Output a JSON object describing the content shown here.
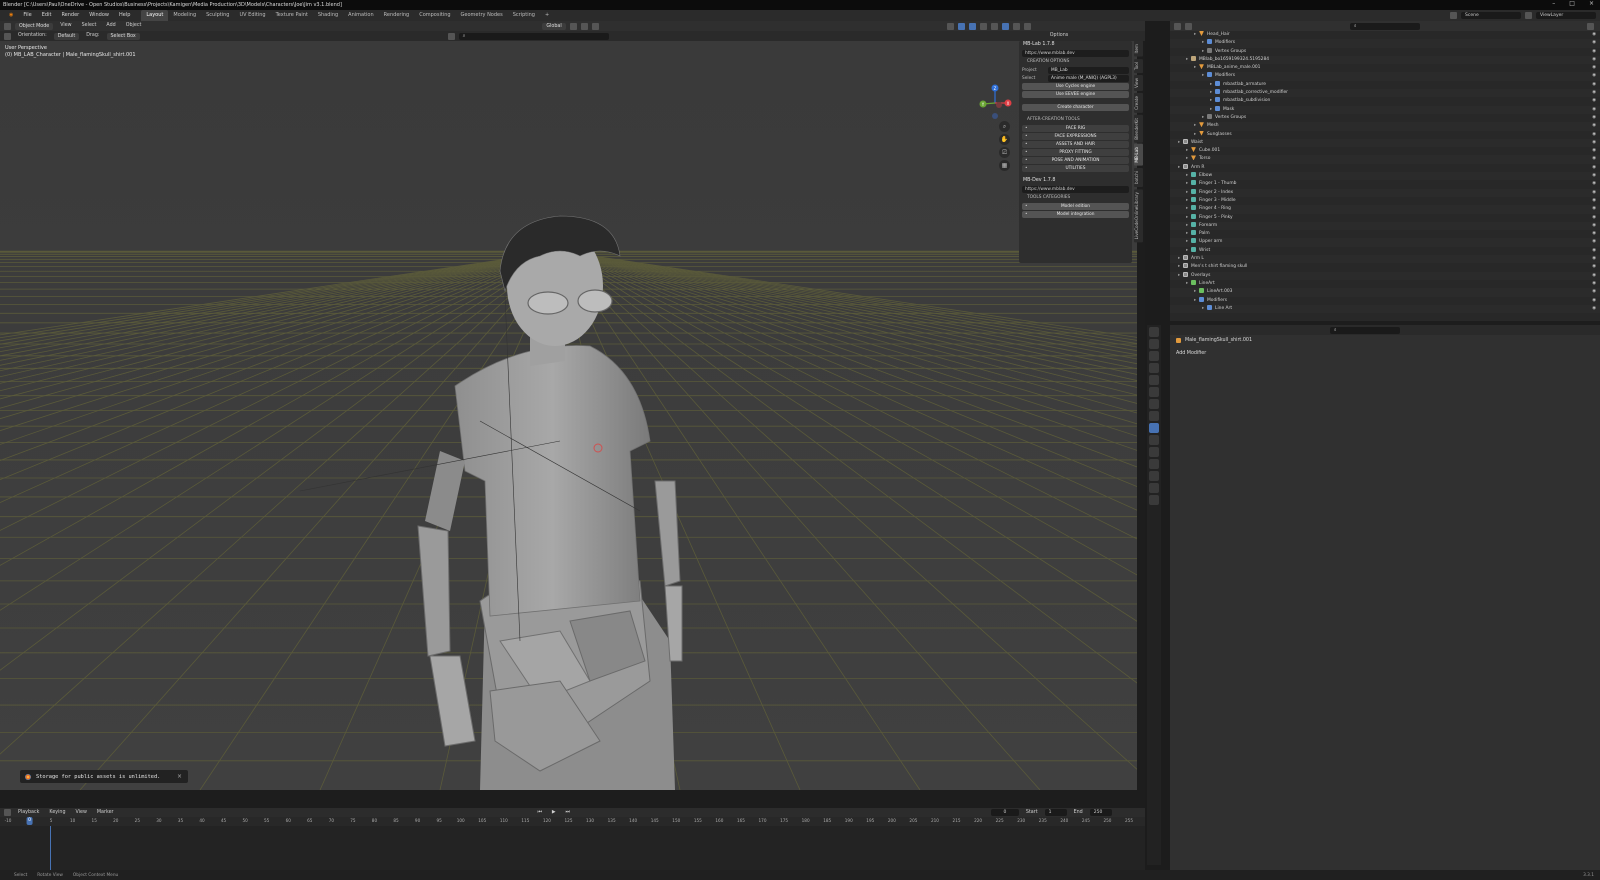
{
  "window": {
    "title": "Blender [C:\\Users\\Paul\\OneDrive - Open Studios\\Business\\Projects\\Kamigen\\Media Production\\3D\\Models\\Characters\\Joe\\Jim v3.1.blend]",
    "controls": [
      "–",
      "□",
      "×"
    ]
  },
  "menubar": {
    "items": [
      "File",
      "Edit",
      "Render",
      "Window",
      "Help"
    ],
    "workspaces": [
      "Layout",
      "Modeling",
      "Sculpting",
      "UV Editing",
      "Texture Paint",
      "Shading",
      "Animation",
      "Rendering",
      "Compositing",
      "Geometry Nodes",
      "Scripting"
    ],
    "active_workspace": "Layout",
    "scene": "Scene",
    "view_layer": "ViewLayer"
  },
  "viewport_header": {
    "mode": "Object Mode",
    "menus": [
      "View",
      "Select",
      "Add",
      "Object"
    ],
    "transform": "Global",
    "orientation_label": "Orientation:",
    "orientation": "Default",
    "drag_label": "Drag:",
    "drag": "Select Box",
    "options": "Options"
  },
  "viewport": {
    "view_name": "User Perspective",
    "object_info": "(0) MB_LAB_Character | Male_flamingSkull_shirt.001"
  },
  "gizmo": {
    "x": "X",
    "y": "Y",
    "z": "Z"
  },
  "npanel": {
    "mblab_title": "MB-Lab 1.7.8",
    "mblab_url": "https://www.mblab.dev",
    "creation_options": "CREATION OPTIONS",
    "project_label": "Project",
    "project_value": "MB_Lab",
    "select_label": "Select",
    "select_value": "Anime male (M_ANIQ) (AGPL3)",
    "use_cycles": "Use Cycles engine",
    "use_eevee": "Use EEVEE engine",
    "create_character": "Create character",
    "after_creation": "AFTER-CREATION TOOLS",
    "tools": [
      "FACE RIG",
      "FACE EXPRESSIONS",
      "ASSETS AND HAIR",
      "PROXY FITTING",
      "POSE AND ANIMATION",
      "UTILITIES"
    ],
    "mbdev_title": "MB-Dev 1.7.8",
    "mbdev_url": "https://www.mblab.dev",
    "tools_categories": "TOOLS CATEGORIES",
    "categories": [
      "Model edition",
      "Model integration"
    ]
  },
  "vtabs": [
    "Item",
    "Tool",
    "View",
    "Create",
    "BlenderKit",
    "MB-Lab",
    "botchi",
    "LiveCodeOnlineLibrary"
  ],
  "toast": {
    "text": "Storage for public assets is unlimited."
  },
  "timeline": {
    "menus": [
      "Playback",
      "Keying",
      "View",
      "Marker"
    ],
    "current_frame": "0",
    "start_label": "Start",
    "start": "1",
    "end_label": "End",
    "end": "250",
    "ticks": [
      "-10",
      "0",
      "5",
      "10",
      "15",
      "20",
      "25",
      "30",
      "35",
      "40",
      "45",
      "50",
      "55",
      "60",
      "65",
      "70",
      "75",
      "80",
      "85",
      "90",
      "95",
      "100",
      "105",
      "110",
      "115",
      "120",
      "125",
      "130",
      "135",
      "140",
      "145",
      "150",
      "155",
      "160",
      "165",
      "170",
      "175",
      "180",
      "185",
      "190",
      "195",
      "200",
      "205",
      "210",
      "215",
      "220",
      "225",
      "230",
      "235",
      "240",
      "245",
      "250",
      "255"
    ]
  },
  "status": {
    "select": "Select",
    "rotate": "Rotate View",
    "context": "Object Context Menu",
    "version": "3.3.1"
  },
  "outliner": {
    "rows": [
      {
        "indent": 2,
        "label": "Head_Hair",
        "icon": "mesh"
      },
      {
        "indent": 3,
        "label": "Modifiers",
        "icon": "mod"
      },
      {
        "indent": 3,
        "label": "Vertex Groups",
        "icon": "grp"
      },
      {
        "indent": 1,
        "label": "MBlab_bo1659199324.5195284",
        "icon": "arm"
      },
      {
        "indent": 2,
        "label": "MBLab_anime_male.001",
        "icon": "mesh"
      },
      {
        "indent": 3,
        "label": "Modifiers",
        "icon": "mod"
      },
      {
        "indent": 4,
        "label": "mbastlab_armature",
        "icon": "mod"
      },
      {
        "indent": 4,
        "label": "mbastlab_corrective_modifier",
        "icon": "mod"
      },
      {
        "indent": 4,
        "label": "mbastlab_subdivision",
        "icon": "mod"
      },
      {
        "indent": 4,
        "label": "Mask",
        "icon": "mod"
      },
      {
        "indent": 3,
        "label": "Vertex Groups",
        "icon": "grp"
      },
      {
        "indent": 2,
        "label": "Mesh",
        "icon": "mesh"
      },
      {
        "indent": 2,
        "label": "Sunglasses",
        "icon": "mesh"
      },
      {
        "indent": 0,
        "label": "Waist",
        "icon": "col"
      },
      {
        "indent": 1,
        "label": "Cube.001",
        "icon": "mesh"
      },
      {
        "indent": 1,
        "label": "Torso",
        "icon": "mesh"
      },
      {
        "indent": 0,
        "label": "Arm R",
        "icon": "col"
      },
      {
        "indent": 1,
        "label": "Elbow",
        "icon": "bone"
      },
      {
        "indent": 1,
        "label": "Finger 1 - Thumb",
        "icon": "bone"
      },
      {
        "indent": 1,
        "label": "Finger 2 - Index",
        "icon": "bone"
      },
      {
        "indent": 1,
        "label": "Finger 3 - Middle",
        "icon": "bone"
      },
      {
        "indent": 1,
        "label": "Finger 4 - Ring",
        "icon": "bone"
      },
      {
        "indent": 1,
        "label": "Finger 5 - Pinky",
        "icon": "bone"
      },
      {
        "indent": 1,
        "label": "Forearm",
        "icon": "bone"
      },
      {
        "indent": 1,
        "label": "Palm",
        "icon": "bone"
      },
      {
        "indent": 1,
        "label": "Upper arm",
        "icon": "bone"
      },
      {
        "indent": 1,
        "label": "Wrist",
        "icon": "bone"
      },
      {
        "indent": 0,
        "label": "Arm L",
        "icon": "col"
      },
      {
        "indent": 0,
        "label": "Men's t shirt flaming skull",
        "icon": "col"
      },
      {
        "indent": 0,
        "label": "Overlays",
        "icon": "col"
      },
      {
        "indent": 1,
        "label": "LineArt",
        "icon": "gp"
      },
      {
        "indent": 2,
        "label": "LineArt.003",
        "icon": "gp"
      },
      {
        "indent": 2,
        "label": "Modifiers",
        "icon": "mod"
      },
      {
        "indent": 3,
        "label": "Line Art",
        "icon": "mod"
      }
    ]
  },
  "properties": {
    "object_name": "Male_flamingSkull_shirt.001",
    "add_modifier": "Add Modifier"
  }
}
